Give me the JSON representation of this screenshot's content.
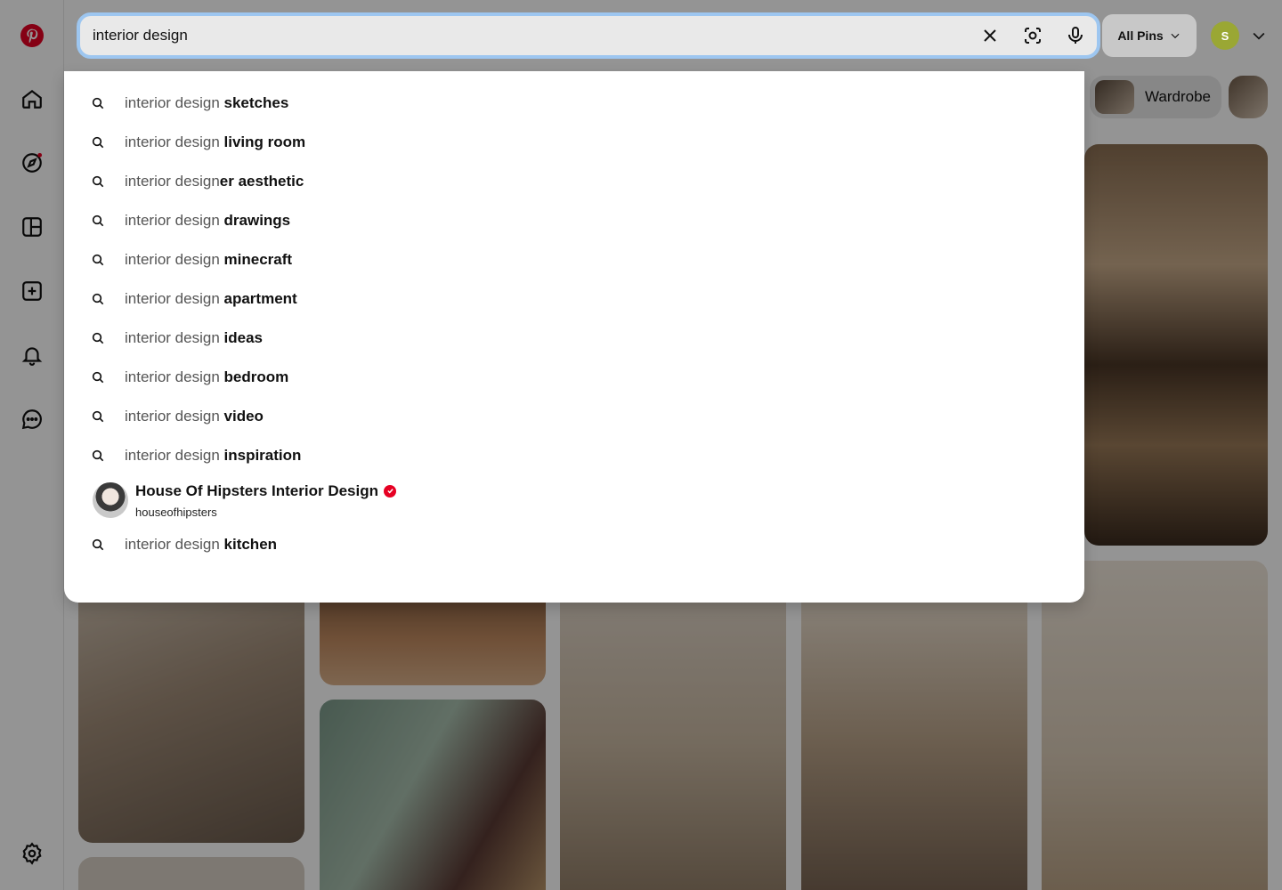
{
  "search": {
    "value": "interior design",
    "placeholder": "Search"
  },
  "filter": {
    "label": "All Pins"
  },
  "account": {
    "initial": "S"
  },
  "chips": [
    "Wardrobe"
  ],
  "suggestions": [
    {
      "prefix": "interior design ",
      "bold": "sketches"
    },
    {
      "prefix": "interior design ",
      "bold": "living room"
    },
    {
      "prefix": "interior design",
      "bold": "er aesthetic"
    },
    {
      "prefix": "interior design ",
      "bold": "drawings"
    },
    {
      "prefix": "interior design ",
      "bold": "minecraft"
    },
    {
      "prefix": "interior design ",
      "bold": "apartment"
    },
    {
      "prefix": "interior design ",
      "bold": "ideas"
    },
    {
      "prefix": "interior design ",
      "bold": "bedroom"
    },
    {
      "prefix": "interior design ",
      "bold": "video"
    },
    {
      "prefix": "interior design ",
      "bold": "inspiration"
    }
  ],
  "profile": {
    "name": "House Of Hipsters Interior Design",
    "handle": "houseofhipsters"
  },
  "last_suggestion": {
    "prefix": "interior design ",
    "bold": "kitchen"
  },
  "colors": {
    "brand": "#e60023",
    "focus_ring": "#9dc6f0",
    "avatar": "#9aa734"
  }
}
